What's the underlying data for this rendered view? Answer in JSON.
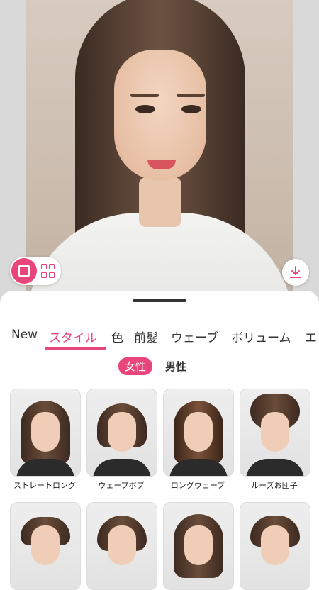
{
  "tabs": [
    "New",
    "スタイル",
    "色",
    "前髪",
    "ウェーブ",
    "ボリューム",
    "エ"
  ],
  "gender": {
    "female": "女性",
    "male": "男性"
  },
  "styles": [
    {
      "label": "ストレートロング"
    },
    {
      "label": "ウェーブボブ"
    },
    {
      "label": "ロングウェーブ"
    },
    {
      "label": "ルーズお団子"
    }
  ],
  "colors": {
    "accent": "#e8467a"
  }
}
